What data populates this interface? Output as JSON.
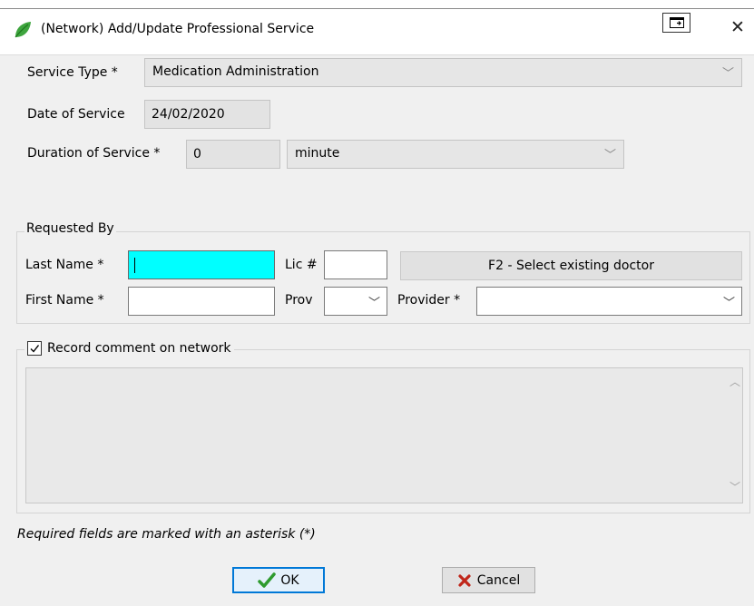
{
  "window": {
    "title": "(Network) Add/Update Professional Service",
    "close_glyph": "✕",
    "leaf_color": "#2f9a2f"
  },
  "service": {
    "type_label": "Service Type *",
    "type_value": "Medication Administration",
    "date_label": "Date of Service",
    "date_value": "24/02/2020",
    "duration_label": "Duration of Service *",
    "duration_value": "0",
    "duration_unit": "minute"
  },
  "requested_by": {
    "legend": "Requested By",
    "last_name_label": "Last Name *",
    "lic_label": "Lic #",
    "select_doctor_label": "F2 - Select existing doctor",
    "first_name_label": "First Name *",
    "prov_label": "Prov",
    "provider_label": "Provider *",
    "last_name_highlight": "#00ffff"
  },
  "comment": {
    "checkbox_label": "Record comment on network",
    "checked": true
  },
  "footer": {
    "required_note": "Required fields are marked with an asterisk (*)",
    "ok_label": "OK",
    "cancel_label": "Cancel",
    "ok_check_color": "#2e9b2e",
    "cancel_x_color": "#c0261a"
  }
}
